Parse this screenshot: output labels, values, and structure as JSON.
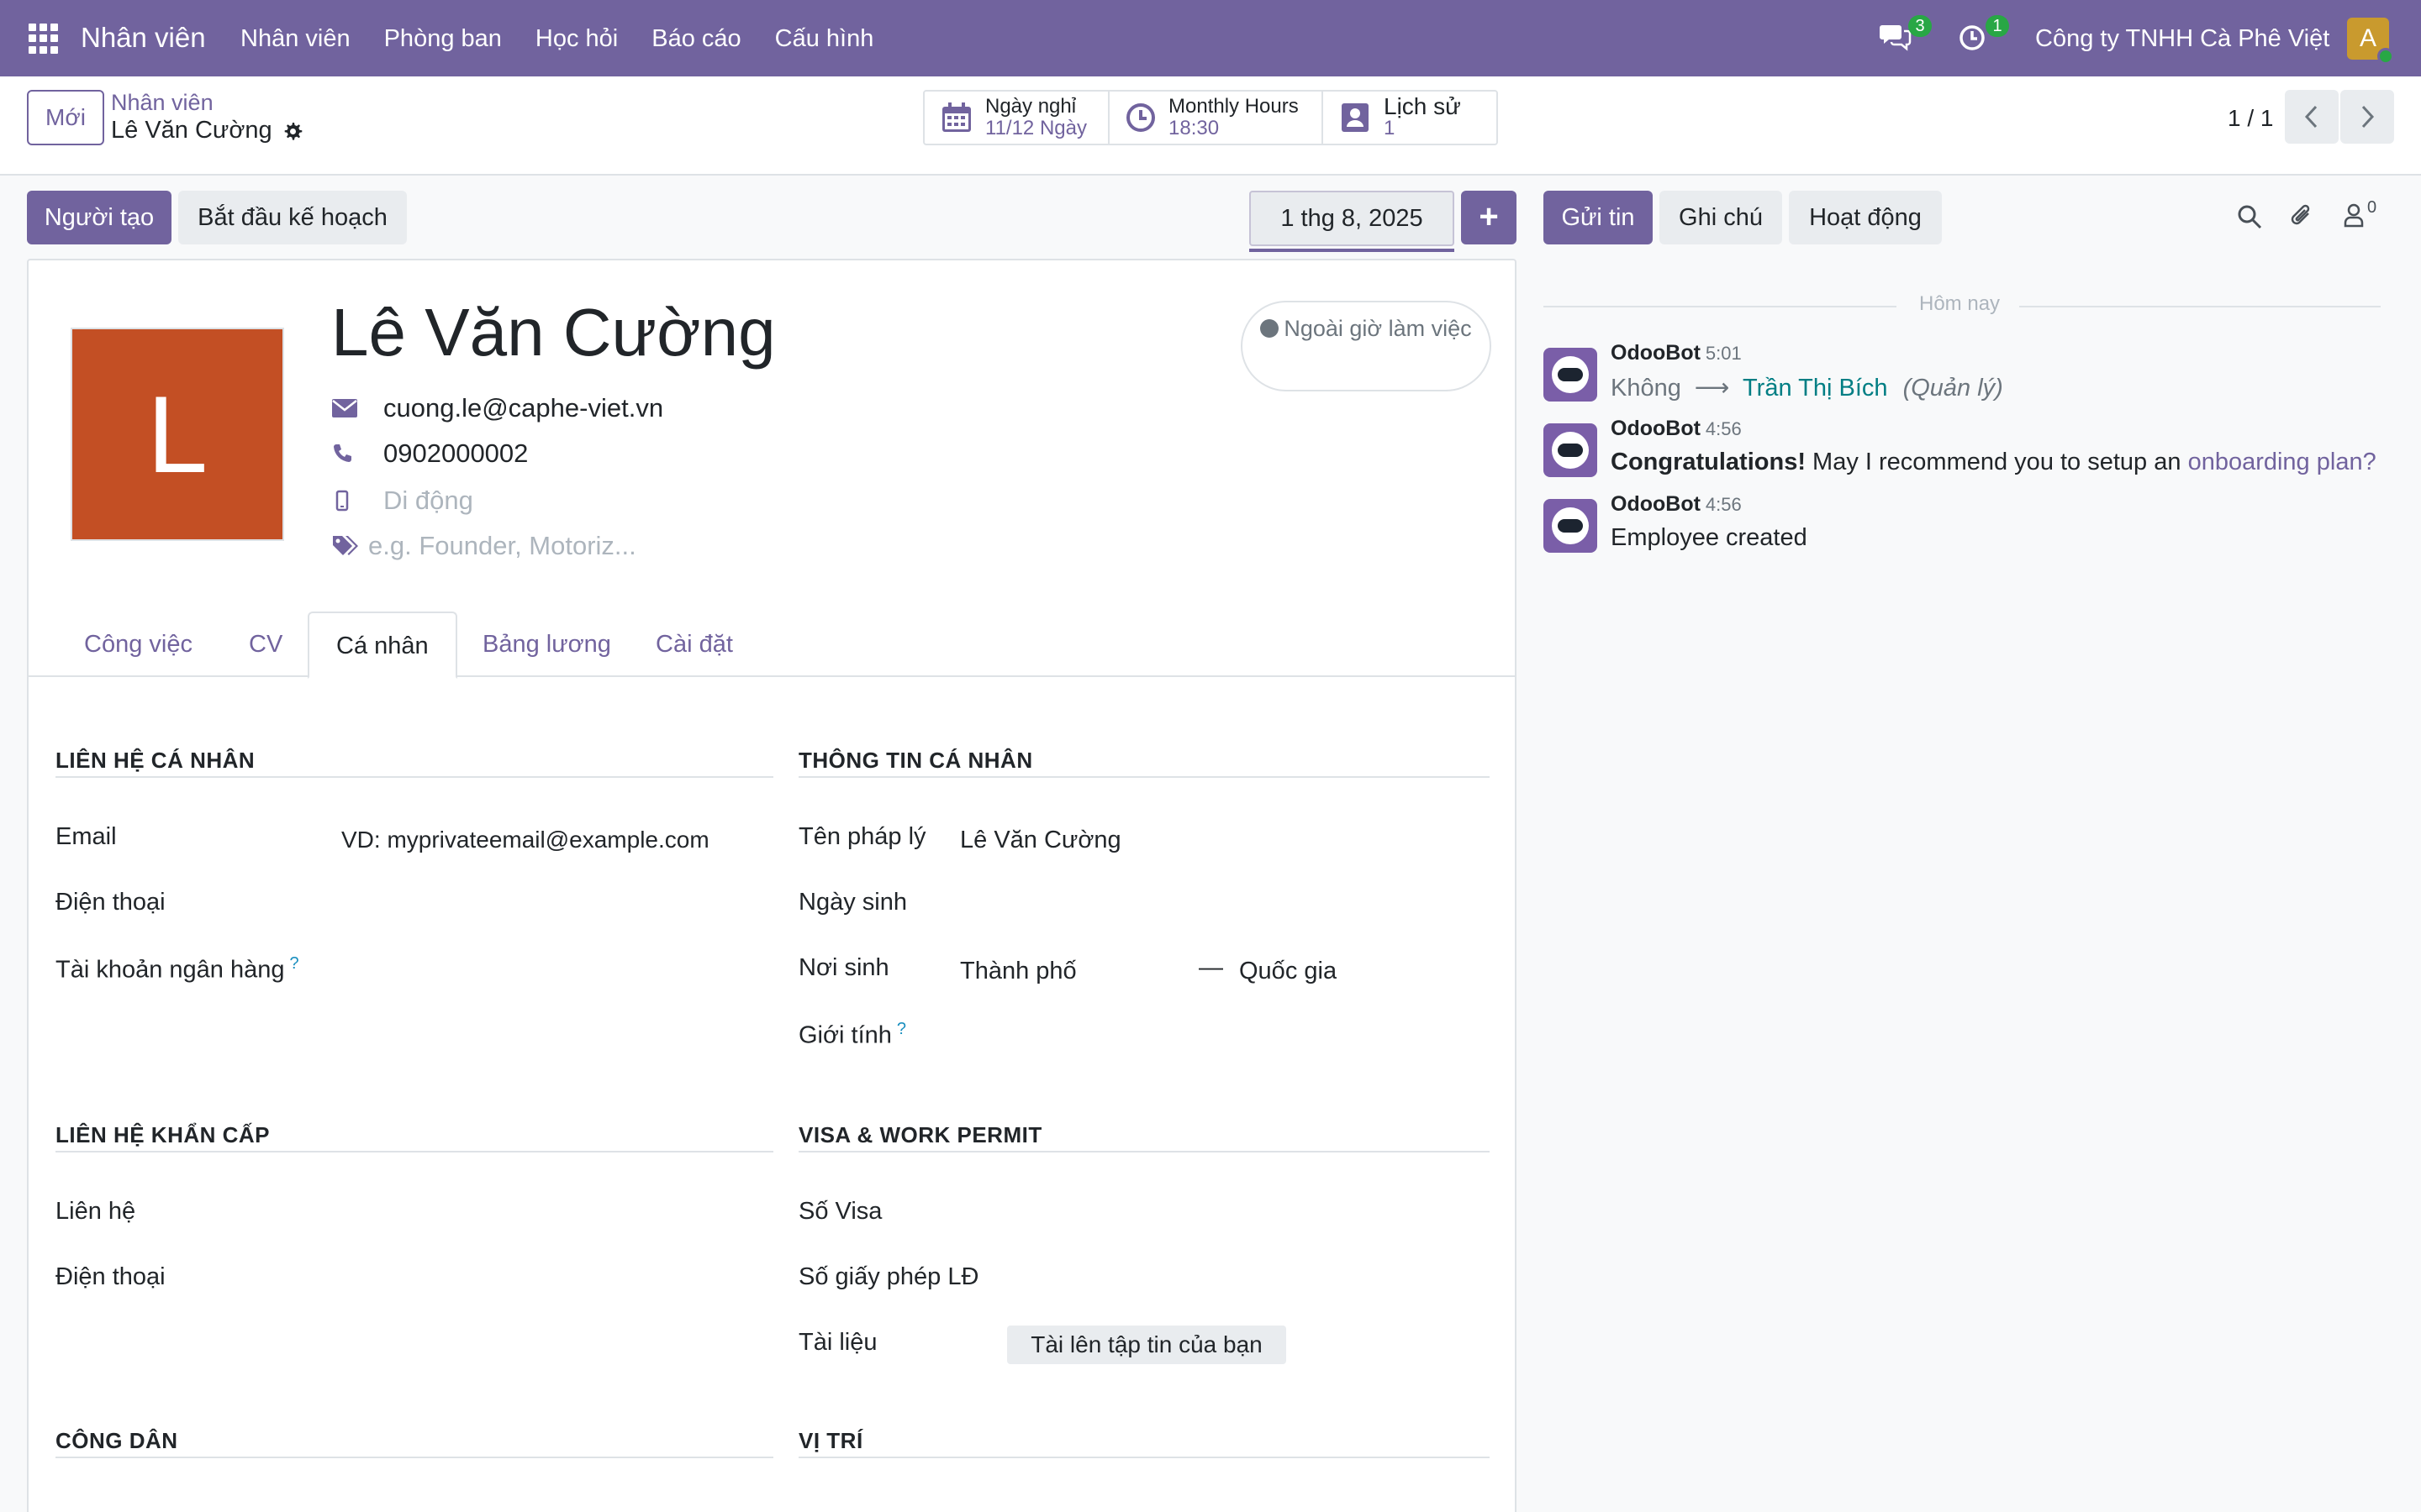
{
  "navbar": {
    "brand": "Nhân viên",
    "menu": [
      "Nhân viên",
      "Phòng ban",
      "Học hỏi",
      "Báo cáo",
      "Cấu hình"
    ],
    "messages_badge": "3",
    "activities_badge": "1",
    "company": "Công ty TNHH Cà Phê Việt",
    "avatar_letter": "A"
  },
  "control": {
    "new_button": "Mới",
    "breadcrumb_parent": "Nhân viên",
    "breadcrumb_current": "Lê Văn Cường",
    "smart_buttons": [
      {
        "label": "Ngày nghỉ",
        "value": "11/12 Ngày",
        "icon": "calendar-icon"
      },
      {
        "label": "Monthly Hours",
        "value": "18:30",
        "icon": "clock-icon"
      },
      {
        "label": "Lịch sử",
        "value": "1",
        "icon": "contact-card-icon"
      }
    ],
    "pager": "1 / 1"
  },
  "actions": {
    "creator_button": "Người tạo",
    "start_plan_button": "Bắt đầu kế hoạch",
    "date": "1 thg 8, 2025",
    "plus": "+",
    "send_message": "Gửi tin",
    "log_note": "Ghi chú",
    "activity": "Hoạt động",
    "followers_count": "0"
  },
  "employee": {
    "avatar_letter": "L",
    "name": "Lê Văn Cường",
    "email": "cuong.le@caphe-viet.vn",
    "phone": "0902000002",
    "mobile_placeholder": "Di động",
    "tags_placeholder": "e.g. Founder, Motoriz...",
    "status": "Ngoài giờ làm việc"
  },
  "tabs": [
    "Công việc",
    "CV",
    "Cá nhân",
    "Bảng lương",
    "Cài đặt"
  ],
  "personal": {
    "contact_title": "LIÊN HỆ CÁ NHÂN",
    "email_label": "Email",
    "email_placeholder": "VD: myprivateemail@example.com",
    "phone_label": "Điện thoại",
    "bank_label": "Tài khoản ngân hàng",
    "info_title": "THÔNG TIN CÁ NHÂN",
    "legal_name_label": "Tên pháp lý",
    "legal_name_value": "Lê Văn Cường",
    "birthday_label": "Ngày sinh",
    "birthplace_label": "Nơi sinh",
    "city_placeholder": "Thành phố",
    "country_placeholder": "Quốc gia",
    "gender_label": "Giới tính",
    "emergency_title": "LIÊN HỆ KHẨN CẤP",
    "emergency_contact_label": "Liên hệ",
    "emergency_phone_label": "Điện thoại",
    "visa_title": "VISA & WORK PERMIT",
    "visa_no_label": "Số Visa",
    "permit_no_label": "Số giấy phép LĐ",
    "documents_label": "Tài liệu",
    "upload_button": "Tài lên tập tin của bạn",
    "citizenship_title": "CÔNG DÂN",
    "location_title": "VỊ TRÍ",
    "help_mark": "?"
  },
  "chatter": {
    "today": "Hôm nay",
    "messages": [
      {
        "author": "OdooBot",
        "time": "5:01",
        "from": "Không",
        "to": "Trần Thị Bích",
        "field": "(Quản lý)"
      },
      {
        "author": "OdooBot",
        "time": "4:56",
        "bold": "Congratulations!",
        "text": " May I recommend you to setup an ",
        "link": "onboarding plan?"
      },
      {
        "author": "OdooBot",
        "time": "4:56",
        "text": "Employee created"
      }
    ]
  }
}
